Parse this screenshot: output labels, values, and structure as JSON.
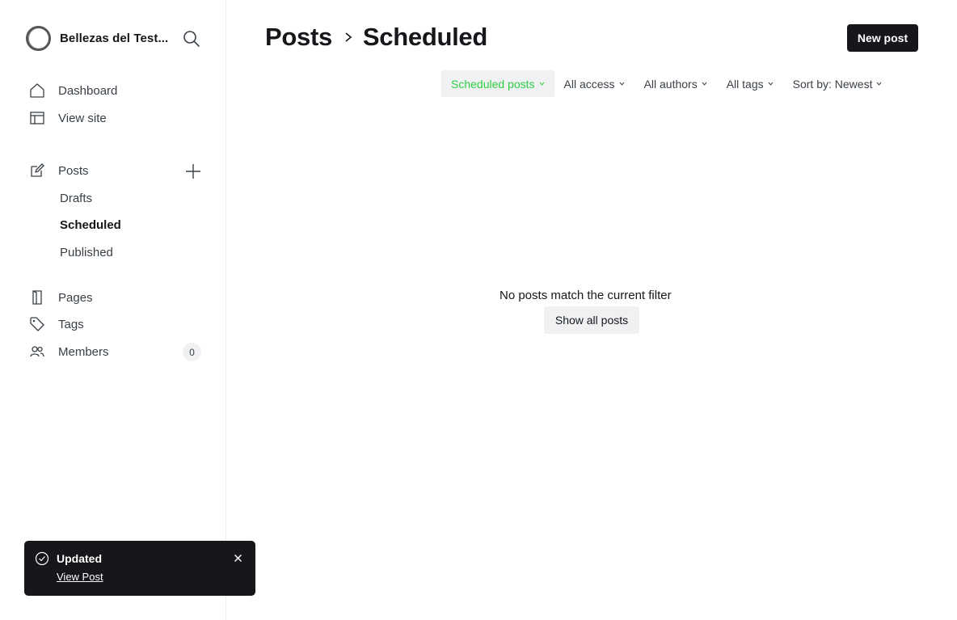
{
  "brand": {
    "name": "Bellezas del Test..."
  },
  "sidebar": {
    "items": [
      {
        "label": "Dashboard",
        "icon": "home-icon"
      },
      {
        "label": "View site",
        "icon": "layout-icon"
      },
      {
        "label": "Posts",
        "icon": "edit-icon"
      },
      {
        "label": "Pages",
        "icon": "page-icon"
      },
      {
        "label": "Tags",
        "icon": "tag-icon"
      },
      {
        "label": "Members",
        "icon": "members-icon",
        "count": "0"
      }
    ],
    "post_subitems": [
      {
        "label": "Drafts"
      },
      {
        "label": "Scheduled",
        "active": true
      },
      {
        "label": "Published"
      }
    ]
  },
  "header": {
    "breadcrumb_parent": "Posts",
    "breadcrumb_current": "Scheduled",
    "new_post_label": "New post"
  },
  "filters": [
    {
      "label": "Scheduled posts",
      "active": true
    },
    {
      "label": "All access"
    },
    {
      "label": "All authors"
    },
    {
      "label": "All tags"
    },
    {
      "label": "Sort by: Newest"
    }
  ],
  "empty_state": {
    "message": "No posts match the current filter",
    "button_label": "Show all posts"
  },
  "toast": {
    "title": "Updated",
    "link_label": "View Post"
  },
  "colors": {
    "accent": "#30cf43",
    "dark": "#15171a",
    "muted_bg": "#eff1f3"
  }
}
